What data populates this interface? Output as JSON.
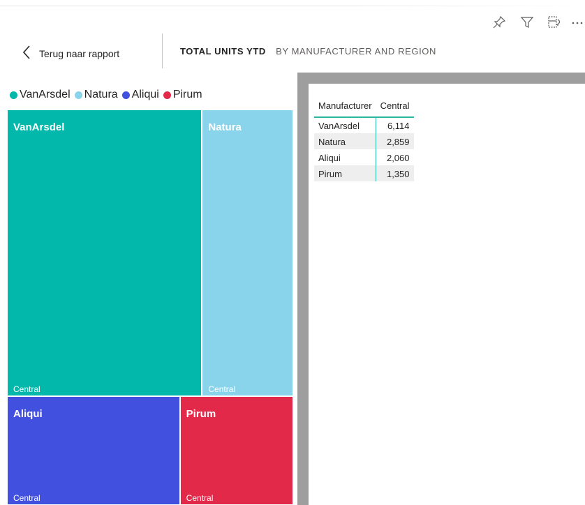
{
  "header": {
    "back_label": "Terug naar rapport",
    "title": "TOTAL UNITS YTD",
    "subtitle": "BY MANUFACTURER AND REGION"
  },
  "toolbar": {
    "icons": [
      "pin-icon",
      "filter-icon",
      "focus-mode-icon",
      "more-options-icon"
    ]
  },
  "legend": [
    {
      "name": "VanArsdel",
      "color": "#01b8aa"
    },
    {
      "name": "Natura",
      "color": "#8ad4eb"
    },
    {
      "name": "Aliqui",
      "color": "#4150de"
    },
    {
      "name": "Pirum",
      "color": "#e3294a"
    }
  ],
  "table": {
    "columns": [
      "Manufacturer",
      "Central"
    ],
    "rows": [
      [
        "VanArsdel",
        "6,114"
      ],
      [
        "Natura",
        "2,859"
      ],
      [
        "Aliqui",
        "2,060"
      ],
      [
        "Pirum",
        "1,350"
      ]
    ]
  },
  "chart_data": {
    "type": "treemap",
    "title": "TOTAL UNITS YTD",
    "subtitle": "BY MANUFACTURER AND REGION",
    "series": [
      {
        "name": "VanArsdel",
        "region": "Central",
        "value": 6114,
        "color": "#01b8aa"
      },
      {
        "name": "Natura",
        "region": "Central",
        "value": 2859,
        "color": "#8ad4eb"
      },
      {
        "name": "Aliqui",
        "region": "Central",
        "value": 2060,
        "color": "#4150de"
      },
      {
        "name": "Pirum",
        "region": "Central",
        "value": 1350,
        "color": "#e3294a"
      }
    ],
    "legend_position": "top-left"
  }
}
